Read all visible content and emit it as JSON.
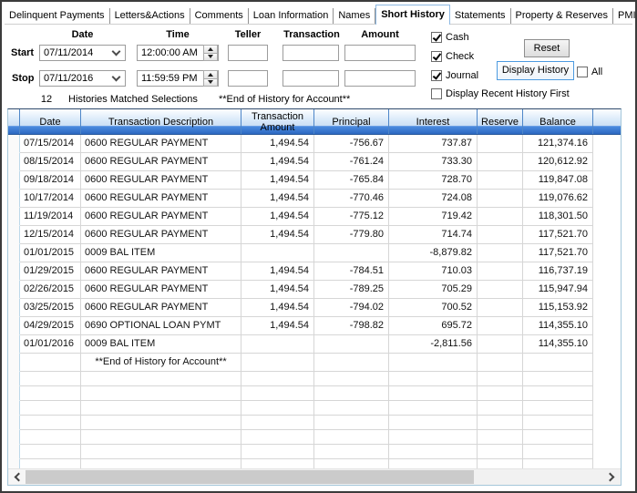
{
  "tabs": [
    {
      "label": "Delinquent Payments",
      "active": false
    },
    {
      "label": "Letters&Actions",
      "active": false
    },
    {
      "label": "Comments",
      "active": false
    },
    {
      "label": "Loan Information",
      "active": false
    },
    {
      "label": "Names",
      "active": false
    },
    {
      "label": "Short History",
      "active": true
    },
    {
      "label": "Statements",
      "active": false
    },
    {
      "label": "Property & Reserves",
      "active": false
    },
    {
      "label": "PMI",
      "active": false
    }
  ],
  "filter": {
    "labels": {
      "date": "Date",
      "time": "Time",
      "teller": "Teller",
      "transaction": "Transaction",
      "amount": "Amount"
    },
    "start": {
      "label": "Start",
      "date": "07/11/2014",
      "time": "12:00:00 AM",
      "teller": "",
      "transaction": "",
      "amount": ""
    },
    "stop": {
      "label": "Stop",
      "date": "07/11/2016",
      "time": "11:59:59 PM",
      "teller": "",
      "transaction": "",
      "amount": ""
    },
    "checkboxes": {
      "cash": {
        "label": "Cash",
        "checked": true
      },
      "check": {
        "label": "Check",
        "checked": true
      },
      "journal": {
        "label": "Journal",
        "checked": true
      },
      "recent_first": {
        "label": "Display Recent History First",
        "checked": false
      },
      "all": {
        "label": "All",
        "checked": false
      }
    },
    "buttons": {
      "reset": "Reset",
      "display_history": "Display History"
    }
  },
  "status": {
    "count": "12",
    "matched_text": "Histories Matched Selections",
    "end_text": "**End of History for Account**"
  },
  "grid": {
    "columns": [
      "Date",
      "Transaction Description",
      "Transaction Amount",
      "Principal",
      "Interest",
      "Reserve",
      "Balance"
    ],
    "rows": [
      [
        "07/15/2014",
        "0600 REGULAR PAYMENT",
        "1,494.54",
        "-756.67",
        "737.87",
        "",
        "121,374.16"
      ],
      [
        "08/15/2014",
        "0600 REGULAR PAYMENT",
        "1,494.54",
        "-761.24",
        "733.30",
        "",
        "120,612.92"
      ],
      [
        "09/18/2014",
        "0600 REGULAR PAYMENT",
        "1,494.54",
        "-765.84",
        "728.70",
        "",
        "119,847.08"
      ],
      [
        "10/17/2014",
        "0600 REGULAR PAYMENT",
        "1,494.54",
        "-770.46",
        "724.08",
        "",
        "119,076.62"
      ],
      [
        "11/19/2014",
        "0600 REGULAR PAYMENT",
        "1,494.54",
        "-775.12",
        "719.42",
        "",
        "118,301.50"
      ],
      [
        "12/15/2014",
        "0600 REGULAR PAYMENT",
        "1,494.54",
        "-779.80",
        "714.74",
        "",
        "117,521.70"
      ],
      [
        "01/01/2015",
        "0009 BAL ITEM",
        "",
        "",
        "-8,879.82",
        "",
        "117,521.70"
      ],
      [
        "01/29/2015",
        "0600 REGULAR PAYMENT",
        "1,494.54",
        "-784.51",
        "710.03",
        "",
        "116,737.19"
      ],
      [
        "02/26/2015",
        "0600 REGULAR PAYMENT",
        "1,494.54",
        "-789.25",
        "705.29",
        "",
        "115,947.94"
      ],
      [
        "03/25/2015",
        "0600 REGULAR PAYMENT",
        "1,494.54",
        "-794.02",
        "700.52",
        "",
        "115,153.92"
      ],
      [
        "04/29/2015",
        "0690 OPTIONAL LOAN PYMT",
        "1,494.54",
        "-798.82",
        "695.72",
        "",
        "114,355.10"
      ],
      [
        "01/01/2016",
        "0009 BAL ITEM",
        "",
        "",
        "-2,811.56",
        "",
        "114,355.10"
      ]
    ],
    "footer_row_text": "**End of History for Account**",
    "empty_row_count": 7
  },
  "icons": {
    "dropdown": "chevron-down",
    "spinner": "up-down-arrows",
    "checkbox_mark": "checkmark",
    "scrollbar_left": "chevron-left",
    "scrollbar_right": "chevron-right"
  },
  "colors": {
    "header_gradient_top": "#fdfeff",
    "header_gradient_blue": "#2c68c1",
    "grid_border": "#a5c7da",
    "gridline": "#d6d6d6",
    "focus_button_border": "#4d9be0",
    "frame": "#3b3b3b"
  }
}
